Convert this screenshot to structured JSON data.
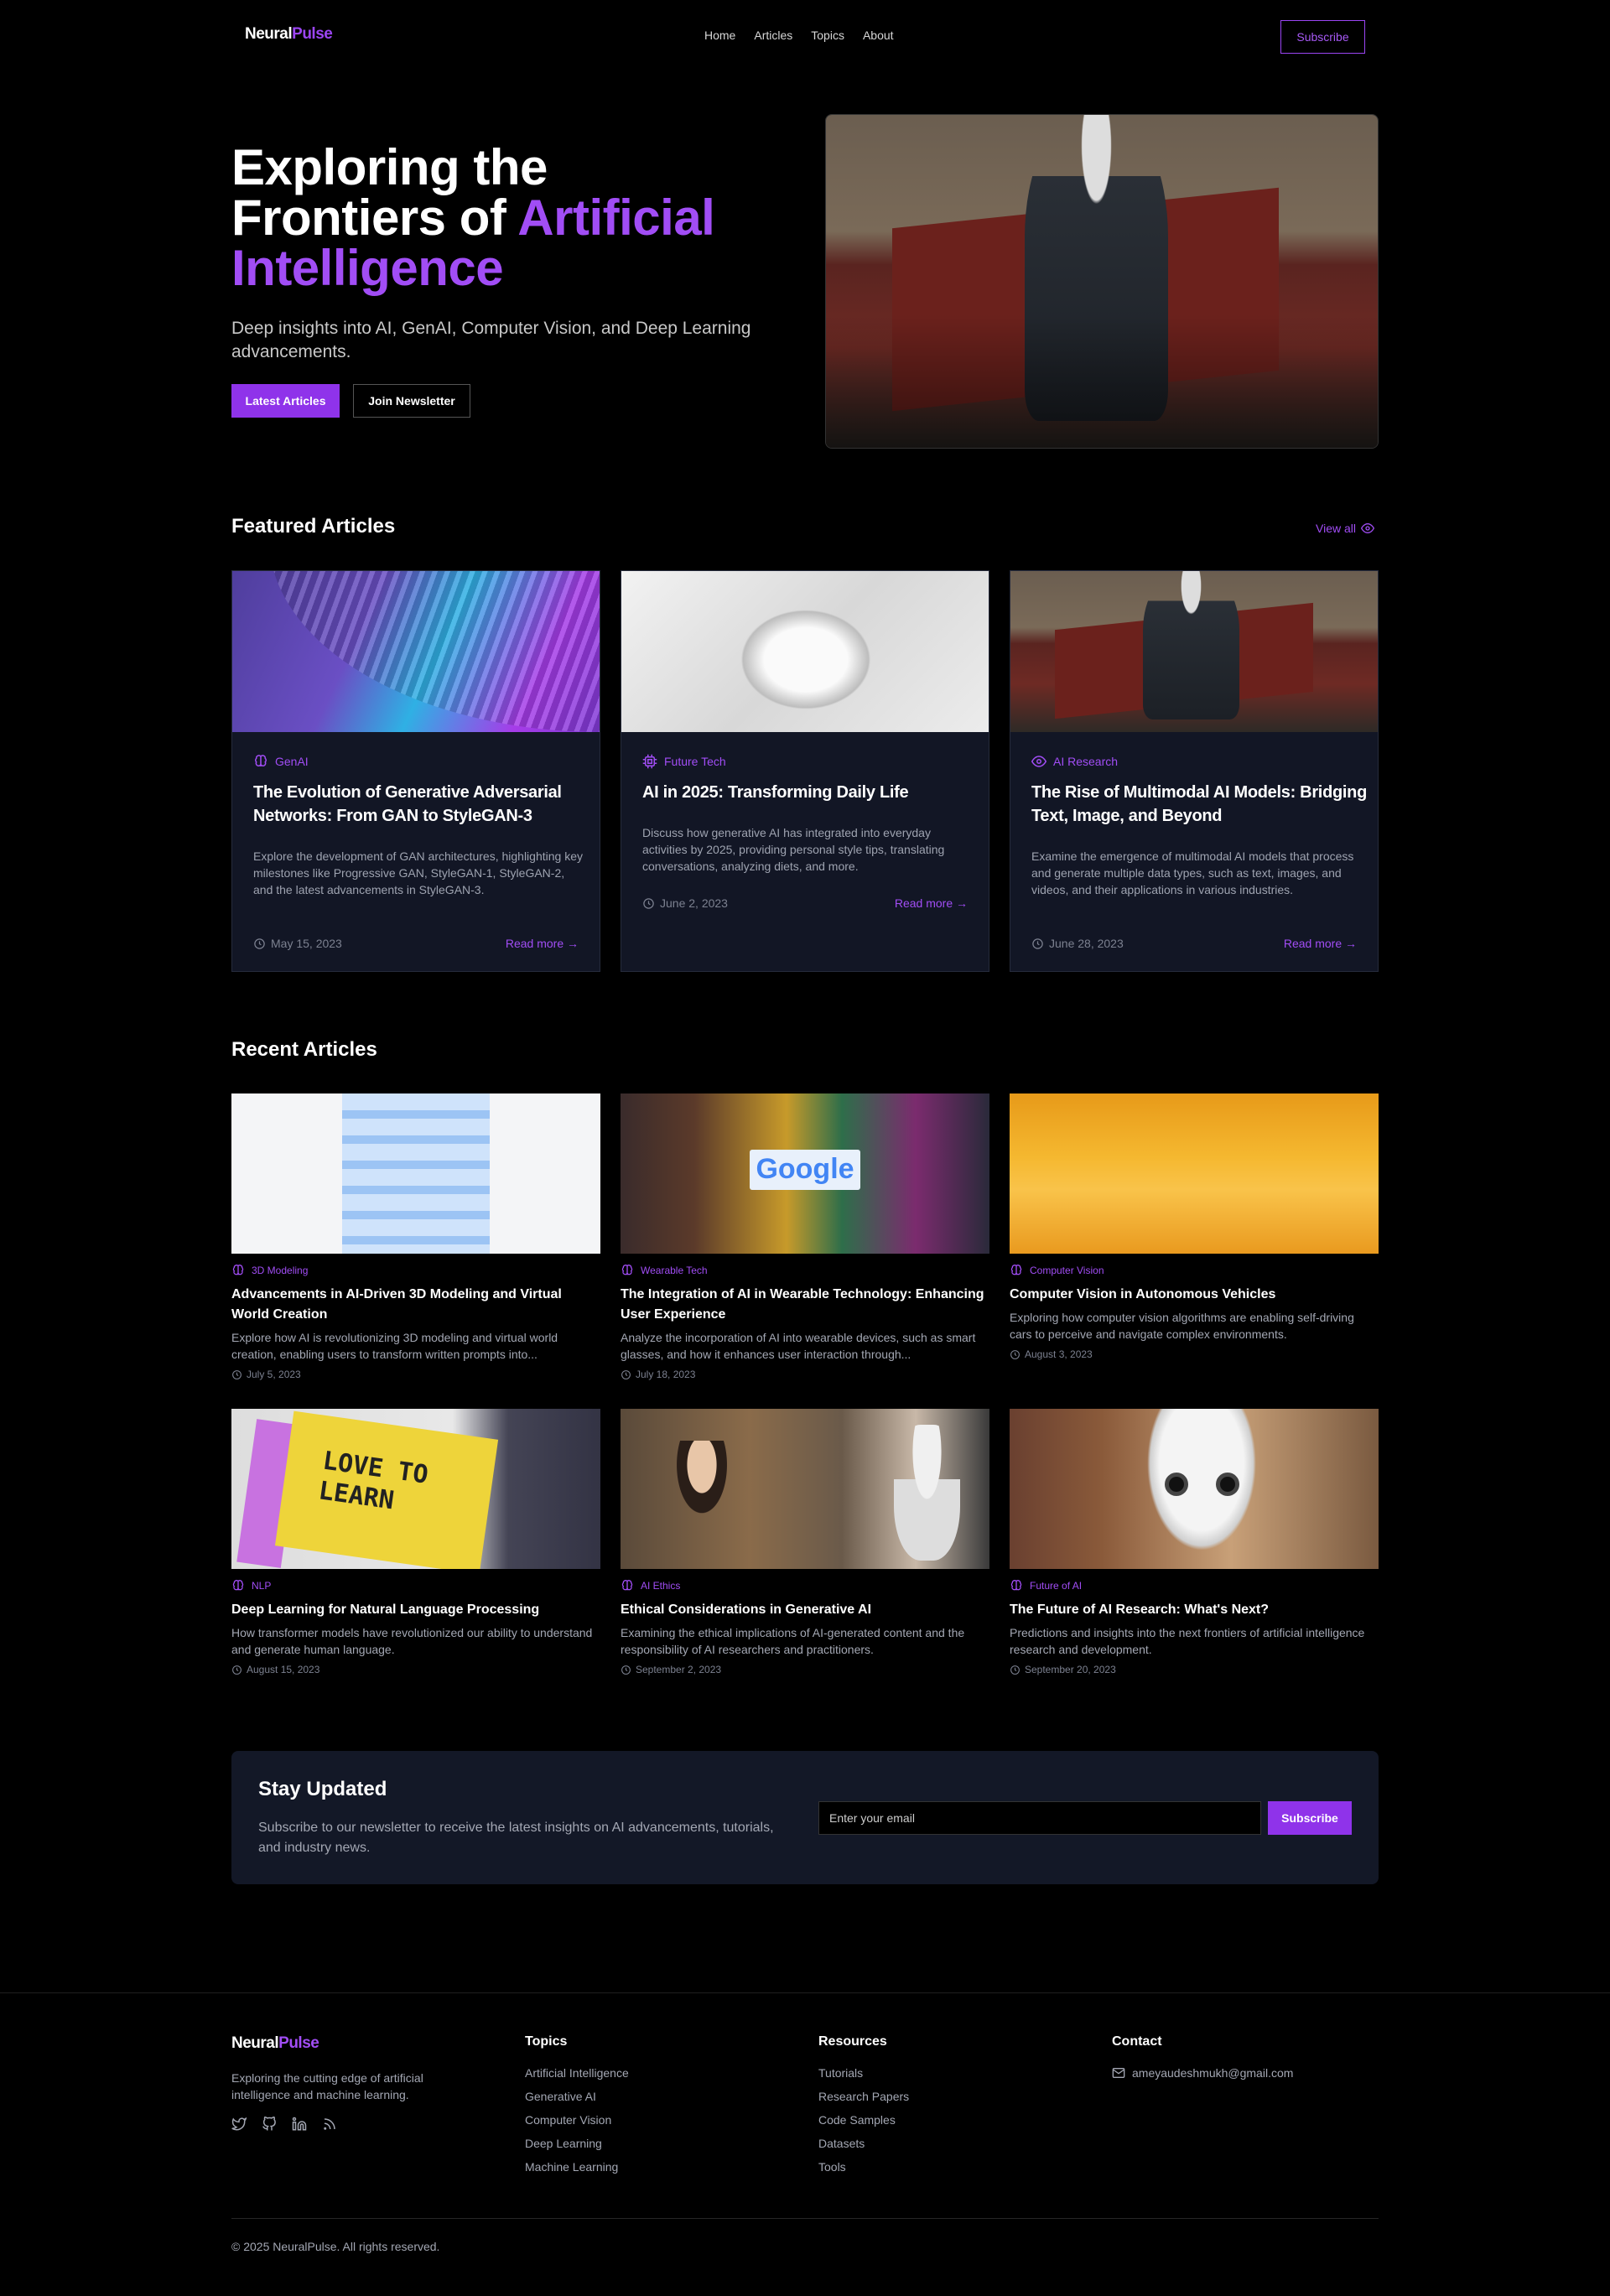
{
  "nav": {
    "logo_primary": "Neural",
    "logo_accent": "Pulse",
    "links": [
      "Home",
      "Articles",
      "Topics",
      "About"
    ],
    "subscribe": "Subscribe"
  },
  "hero": {
    "title_line1": "Exploring the",
    "title_line2a": "Frontiers of ",
    "title_line2b": "Artificial",
    "title_line3": "Intelligence",
    "subtitle": "Deep insights into AI, GenAI, Computer Vision, and Deep Learning advancements.",
    "btn_primary": "Latest Articles",
    "btn_secondary": "Join Newsletter"
  },
  "featured": {
    "heading": "Featured Articles",
    "view_all": "View all",
    "cards": [
      {
        "category": "GenAI",
        "title": "The Evolution of Generative Adversarial Networks: From GAN to StyleGAN-3",
        "desc": "Explore the development of GAN architectures, highlighting key milestones like Progressive GAN, StyleGAN-1, StyleGAN-2, and the latest advancements in StyleGAN-3.",
        "date": "May 15, 2023",
        "more": "Read more →"
      },
      {
        "category": "Future Tech",
        "title": "AI in 2025: Transforming Daily Life",
        "desc": "Discuss how generative AI has integrated into everyday activities by 2025, providing personal style tips, translating conversations, analyzing diets, and more.",
        "date": "June 2, 2023",
        "more": "Read more →"
      },
      {
        "category": "AI Research",
        "title": "The Rise of Multimodal AI Models: Bridging Text, Image, and Beyond",
        "desc": "Examine the emergence of multimodal AI models that process and generate multiple data types, such as text, images, and videos, and their applications in various industries.",
        "date": "June 28, 2023",
        "more": "Read more →"
      }
    ]
  },
  "recent": {
    "heading": "Recent Articles",
    "cards": [
      {
        "category": "3D Modeling",
        "title": "Advancements in AI-Driven 3D Modeling and Virtual World Creation",
        "desc": "Explore how AI is revolutionizing 3D modeling and virtual world creation, enabling users to transform written prompts into...",
        "date": "July 5, 2023"
      },
      {
        "category": "Wearable Tech",
        "title": "The Integration of AI in Wearable Technology: Enhancing User Experience",
        "desc": "Analyze the incorporation of AI into wearable devices, such as smart glasses, and how it enhances user interaction through...",
        "date": "July 18, 2023"
      },
      {
        "category": "Computer Vision",
        "title": "Computer Vision in Autonomous Vehicles",
        "desc": "Exploring how computer vision algorithms are enabling self-driving cars to perceive and navigate complex environments.",
        "date": "August 3, 2023"
      },
      {
        "category": "NLP",
        "title": "Deep Learning for Natural Language Processing",
        "desc": "How transformer models have revolutionized our ability to understand and generate human language.",
        "date": "August 15, 2023"
      },
      {
        "category": "AI Ethics",
        "title": "Ethical Considerations in Generative AI",
        "desc": "Examining the ethical implications of AI-generated content and the responsibility of AI researchers and practitioners.",
        "date": "September 2, 2023"
      },
      {
        "category": "Future of AI",
        "title": "The Future of AI Research: What's Next?",
        "desc": "Predictions and insights into the next frontiers of artificial intelligence research and development.",
        "date": "September 20, 2023"
      }
    ]
  },
  "image_text": {
    "google": "Google",
    "pencil_line1": "LOVE TO",
    "pencil_line2": "LEARN"
  },
  "newsletter": {
    "heading": "Stay Updated",
    "text": "Subscribe to our newsletter to receive the latest insights on AI advancements, tutorials, and industry news.",
    "placeholder": "Enter your email",
    "button": "Subscribe"
  },
  "footer": {
    "tagline": "Exploring the cutting edge of artificial intelligence and machine learning.",
    "topics_heading": "Topics",
    "topics": [
      "Artificial Intelligence",
      "Generative AI",
      "Computer Vision",
      "Deep Learning",
      "Machine Learning"
    ],
    "resources_heading": "Resources",
    "resources": [
      "Tutorials",
      "Research Papers",
      "Code Samples",
      "Datasets",
      "Tools"
    ],
    "contact_heading": "Contact",
    "email": "ameyaudeshmukh@gmail.com",
    "copyright": "© 2025 NeuralPulse. All rights reserved."
  },
  "colors": {
    "accent": "#9b45f3",
    "card_bg": "#121625",
    "page_bg": "#000000"
  }
}
